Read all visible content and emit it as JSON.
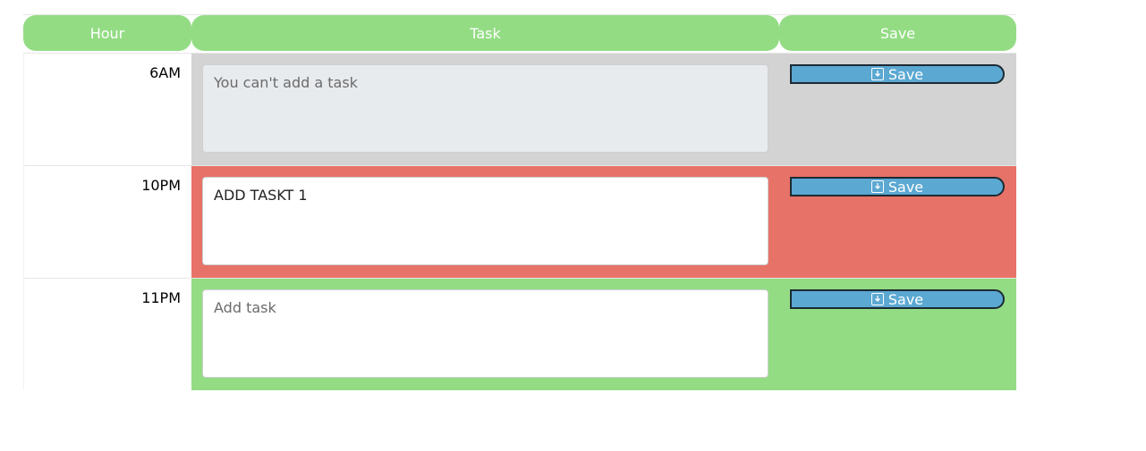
{
  "header": {
    "hour": "Hour",
    "task": "Task",
    "save": "Save"
  },
  "colors": {
    "header": "#93dc84",
    "past": "#d3d3d3",
    "present": "#e77267",
    "future": "#93dc84",
    "save_button": "#5ba8d2"
  },
  "rows": [
    {
      "hour": "6AM",
      "state": "past",
      "task_value": "",
      "task_placeholder": "You can't add a task",
      "save_label": "Save",
      "save_icon": "download-icon"
    },
    {
      "hour": "10PM",
      "state": "present",
      "task_value": "ADD TASKT 1",
      "task_placeholder": "",
      "save_label": "Save",
      "save_icon": "download-icon"
    },
    {
      "hour": "11PM",
      "state": "future",
      "task_value": "",
      "task_placeholder": "Add task",
      "save_label": "Save",
      "save_icon": "download-icon"
    }
  ]
}
